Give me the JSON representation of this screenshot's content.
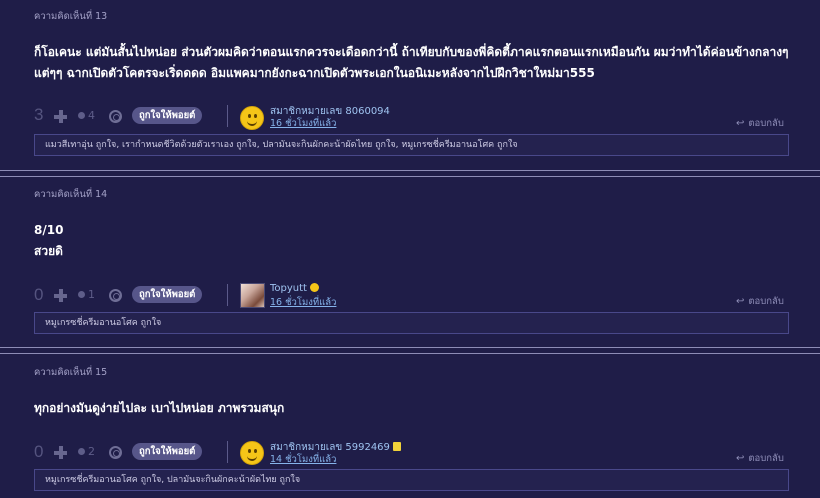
{
  "comments": [
    {
      "header": "ความคิดเห็นที่ 13",
      "body_lines": [
        "ก็โอเคนะ แต่มันสั้นไปหน่อย ส่วนตัวผมคิดว่าตอนแรกควรจะเดือดกว่านี้ ถ้าเทียบกับของพี่คิดตี้ภาคแรกตอนแรกเหมือนกัน ผมว่าทำได้ค่อนข้างกลางๆ",
        "แต่ๆๆ ฉากเปิดตัวโคตรจะเริ่ดดดด อิมแพคมากยังกะฉากเปิดตัวพระเอกในอนิเมะหลังจากไปฝึกวิชาใหม่มา555"
      ],
      "score": "3",
      "emotion_count": "4",
      "like_label": "ถูกใจให้พอยต์",
      "username": "สมาชิกหมายเลข 8060094",
      "time": "16 ชั่วโมงที่แล้ว",
      "avatar": "smiley",
      "reply_label": "ตอบกลับ",
      "likers": "แมวสีเทาอุ่น ถูกใจ, เรากำหนดชีวิตด้วยตัวเราเอง ถูกใจ, ปลามันจะกินผักคะน้าผัดไทย ถูกใจ, หมูเกรซชี่ครีมอานอโศค ถูกใจ"
    },
    {
      "header": "ความคิดเห็นที่ 14",
      "body_lines": [
        "8/10",
        "สวยดิ"
      ],
      "score": "0",
      "emotion_count": "1",
      "like_label": "ถูกใจให้พอยต์",
      "username": "Topyutt",
      "time": "16 ชั่วโมงที่แล้ว",
      "avatar": "photo",
      "reply_label": "ตอบกลับ",
      "likers": "หมูเกรซชี่ครีมอานอโศค ถูกใจ"
    },
    {
      "header": "ความคิดเห็นที่ 15",
      "body_lines": [
        "ทุกอย่างมันดูง่ายไปละ เบาไปหน่อย ภาพรวมสนุก"
      ],
      "score": "0",
      "emotion_count": "2",
      "like_label": "ถูกใจให้พอยต์",
      "username": "สมาชิกหมายเลข 5992469",
      "time": "14 ชั่วโมงที่แล้ว",
      "avatar": "smiley",
      "reply_label": "ตอบกลับ",
      "likers": "หมูเกรซชี่ครีมอานอโศค ถูกใจ, ปลามันจะกินผักคะน้าผัดไทย ถูกใจ"
    }
  ],
  "colors": {
    "background": "#1f1d48",
    "like_button": "#57568a",
    "username": "#9fc3f0"
  }
}
